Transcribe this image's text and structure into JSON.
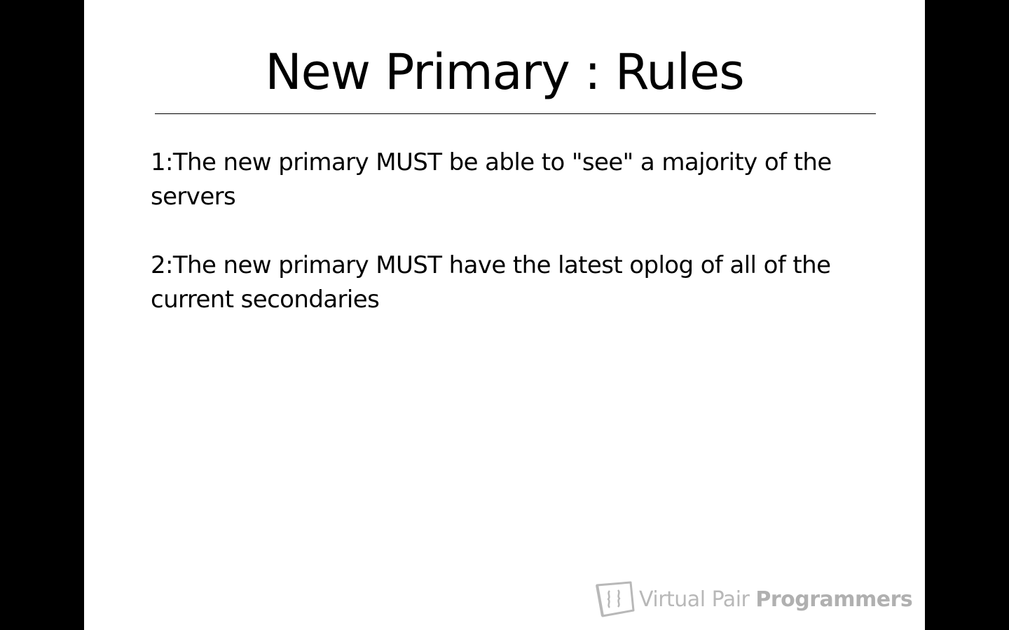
{
  "slide": {
    "title": "New Primary : Rules",
    "rules": [
      "1:The new primary MUST be able to \"see\" a majority of the servers",
      "2:The new primary MUST have the latest oplog of all of the current secondaries"
    ]
  },
  "watermark": {
    "brand_light": "Virtual Pair",
    "brand_bold": "Programmers",
    "icon": "vpp-logo-icon",
    "color": "#b8b8b8"
  },
  "colors": {
    "background": "#000000",
    "slide": "#ffffff",
    "text": "#000000"
  }
}
